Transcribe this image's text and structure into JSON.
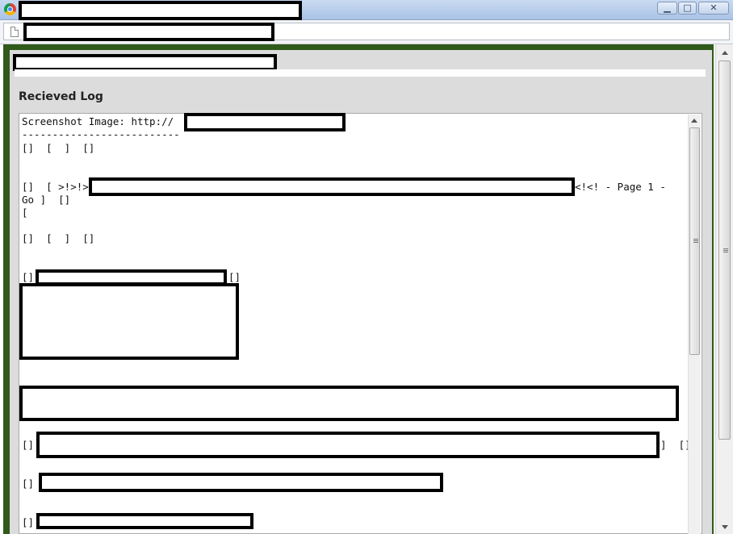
{
  "window": {
    "buttons": {
      "minimize": "▁",
      "maximize": "□",
      "close": "✕"
    }
  },
  "log": {
    "heading": "Recieved Log",
    "lines": {
      "l1": "Screenshot Image: http://",
      "l2": "--------------------------",
      "l3": "[]  [  ]  []",
      "l4_prefix": "[]  [ >!>!>",
      "l4_suffix": "<!<! - Page 1 -",
      "l5": "Go ]  []",
      "l6": "[",
      "l7": "[]  [  ]  []",
      "l8_prefix": "[]",
      "l8_suffix": "[]",
      "l9_prefix": "[]",
      "l9_suffix": "]  []",
      "l10_prefix": "[]",
      "l11_prefix": "[]"
    }
  }
}
